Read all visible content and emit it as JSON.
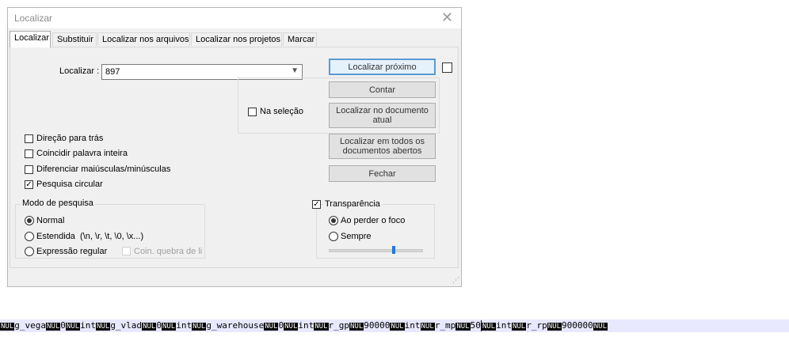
{
  "window": {
    "title": "Localizar",
    "close_glyph": "✕"
  },
  "tabs": [
    {
      "label": "Localizar",
      "active": true
    },
    {
      "label": "Substituir"
    },
    {
      "label": "Localizar nos arquivos"
    },
    {
      "label": "Localizar nos projetos"
    },
    {
      "label": "Marcar"
    }
  ],
  "find": {
    "label": "Localizar :",
    "value": "897"
  },
  "buttons": {
    "find_next": "Localizar próximo",
    "count": "Contar",
    "find_in_current": "Localizar no documento atual",
    "find_in_all": "Localizar em todos os documentos abertos",
    "close": "Fechar"
  },
  "options": {
    "in_selection": "Na seleção",
    "backward": "Direção para trás",
    "whole_word": "Coincidir palavra inteira",
    "match_case": "Diferenciar maiúsculas/minúsculas",
    "wrap_around": "Pesquisa circular",
    "wrap_checked": true
  },
  "search_mode": {
    "title": "Modo de pesquisa",
    "normal": "Normal",
    "extended": "Estendida  (\\n, \\r, \\t, \\0, \\x...)",
    "regex": "Expressão regular",
    "matches_newline": "Coin. quebra de lir",
    "selected": "normal"
  },
  "transparency": {
    "label": "Transparência",
    "checked": true,
    "on_lose_focus": "Ao perder o foco",
    "always": "Sempre",
    "slider_value": 0.7
  },
  "editor_line": [
    {
      "t": "nul",
      "v": "NUL"
    },
    {
      "t": "txt",
      "v": "g_vega"
    },
    {
      "t": "nul",
      "v": "NUL"
    },
    {
      "t": "txt",
      "v": "0"
    },
    {
      "t": "nul",
      "v": "NUL"
    },
    {
      "t": "txt",
      "v": "int"
    },
    {
      "t": "nul",
      "v": "NUL"
    },
    {
      "t": "txt",
      "v": "g_vlad"
    },
    {
      "t": "nul",
      "v": "NUL"
    },
    {
      "t": "txt",
      "v": "0"
    },
    {
      "t": "nul",
      "v": "NUL"
    },
    {
      "t": "txt",
      "v": "int"
    },
    {
      "t": "nul",
      "v": "NUL"
    },
    {
      "t": "txt",
      "v": "g_warehouse"
    },
    {
      "t": "nul",
      "v": "NUL"
    },
    {
      "t": "txt",
      "v": "0"
    },
    {
      "t": "nul",
      "v": "NUL"
    },
    {
      "t": "txt",
      "v": "int"
    },
    {
      "t": "nul",
      "v": "NUL"
    },
    {
      "t": "txt",
      "v": "r_gp"
    },
    {
      "t": "nul",
      "v": "NUL"
    },
    {
      "t": "txt",
      "v": "90000"
    },
    {
      "t": "nul",
      "v": "NUL"
    },
    {
      "t": "txt",
      "v": "int"
    },
    {
      "t": "nul",
      "v": "NUL"
    },
    {
      "t": "txt",
      "v": "r_mp"
    },
    {
      "t": "nul",
      "v": "NUL"
    },
    {
      "t": "txt",
      "v": "50"
    },
    {
      "t": "caret",
      "v": ""
    },
    {
      "t": "nul",
      "v": "NUL"
    },
    {
      "t": "txt",
      "v": "int"
    },
    {
      "t": "nul",
      "v": "NUL"
    },
    {
      "t": "txt",
      "v": "r_rp"
    },
    {
      "t": "nul",
      "v": "NUL"
    },
    {
      "t": "txt",
      "v": "900000"
    },
    {
      "t": "nul",
      "v": "NUL"
    }
  ]
}
